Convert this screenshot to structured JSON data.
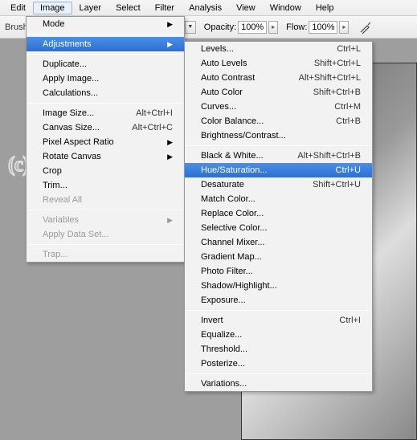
{
  "menubar": {
    "items": [
      "Edit",
      "Image",
      "Layer",
      "Select",
      "Filter",
      "Analysis",
      "View",
      "Window",
      "Help"
    ],
    "open_index": 1
  },
  "toolbar": {
    "brush_label": "Brush:",
    "opacity_label": "Opacity:",
    "opacity_value": "100%",
    "flow_label": "Flow:",
    "flow_value": "100%"
  },
  "image_menu": {
    "mode": "Mode",
    "adjustments": "Adjustments",
    "duplicate": "Duplicate...",
    "apply_image": "Apply Image...",
    "calculations": "Calculations...",
    "image_size": "Image Size...",
    "image_size_sc": "Alt+Ctrl+I",
    "canvas_size": "Canvas Size...",
    "canvas_size_sc": "Alt+Ctrl+C",
    "pixel_aspect": "Pixel Aspect Ratio",
    "rotate_canvas": "Rotate Canvas",
    "crop": "Crop",
    "trim": "Trim...",
    "reveal_all": "Reveal All",
    "variables": "Variables",
    "apply_data_set": "Apply Data Set...",
    "trap": "Trap..."
  },
  "adjust_menu": {
    "levels": "Levels...",
    "levels_sc": "Ctrl+L",
    "auto_levels": "Auto Levels",
    "auto_levels_sc": "Shift+Ctrl+L",
    "auto_contrast": "Auto Contrast",
    "auto_contrast_sc": "Alt+Shift+Ctrl+L",
    "auto_color": "Auto Color",
    "auto_color_sc": "Shift+Ctrl+B",
    "curves": "Curves...",
    "curves_sc": "Ctrl+M",
    "color_balance": "Color Balance...",
    "color_balance_sc": "Ctrl+B",
    "brightness": "Brightness/Contrast...",
    "black_white": "Black & White...",
    "black_white_sc": "Alt+Shift+Ctrl+B",
    "hue_sat": "Hue/Saturation...",
    "hue_sat_sc": "Ctrl+U",
    "desaturate": "Desaturate",
    "desaturate_sc": "Shift+Ctrl+U",
    "match_color": "Match Color...",
    "replace_color": "Replace Color...",
    "selective_color": "Selective Color...",
    "channel_mixer": "Channel Mixer...",
    "gradient_map": "Gradient Map...",
    "photo_filter": "Photo Filter...",
    "shadow_highlight": "Shadow/Highlight...",
    "exposure": "Exposure...",
    "invert": "Invert",
    "invert_sc": "Ctrl+I",
    "equalize": "Equalize...",
    "threshold": "Threshold...",
    "posterize": "Posterize...",
    "variations": "Variations..."
  },
  "watermark": "(c)manny-the-dino.tutorials"
}
